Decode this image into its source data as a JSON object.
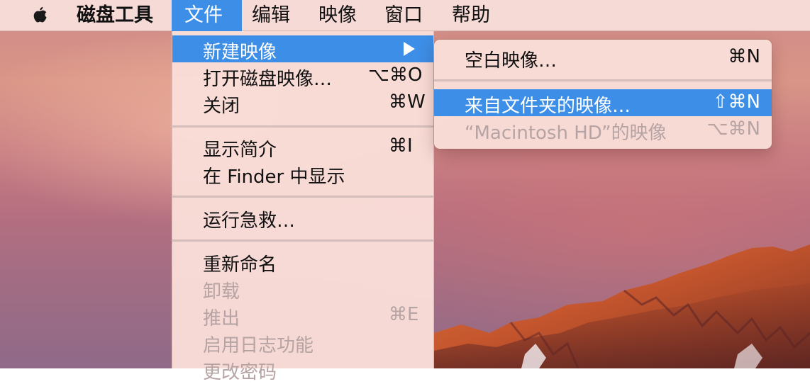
{
  "menubar": {
    "apple_icon": "apple-logo-icon",
    "app_name": "磁盘工具",
    "items": [
      "文件",
      "编辑",
      "映像",
      "窗口",
      "帮助"
    ]
  },
  "file_menu": {
    "new_image": {
      "label": "新建映像",
      "submenu_icon": "triangle-right-icon"
    },
    "open_disk_image": {
      "label": "打开磁盘映像…",
      "shortcut": "⌥⌘O"
    },
    "close": {
      "label": "关闭",
      "shortcut": "⌘W"
    },
    "get_info": {
      "label": "显示简介",
      "shortcut": "⌘I"
    },
    "show_in_finder": {
      "label": "在 Finder 中显示"
    },
    "first_aid": {
      "label": "运行急救…"
    },
    "rename": {
      "label": "重新命名"
    },
    "unmount": {
      "label": "卸载"
    },
    "eject": {
      "label": "推出",
      "shortcut": "⌘E"
    },
    "enable_journaling": {
      "label": "启用日志功能"
    },
    "change_password": {
      "label": "更改密码"
    }
  },
  "new_image_submenu": {
    "blank_image": {
      "label": "空白映像…",
      "shortcut": "⌘N"
    },
    "image_from_folder": {
      "label": "来自文件夹的映像…",
      "shortcut": "⇧⌘N"
    },
    "image_from_disk": {
      "label": "“Macintosh HD”的映像",
      "shortcut": "⌥⌘N"
    }
  },
  "colors": {
    "highlight": "#3d8ee6",
    "menu_background": "#fadedb",
    "disabled_text": "#b6a3a3"
  }
}
